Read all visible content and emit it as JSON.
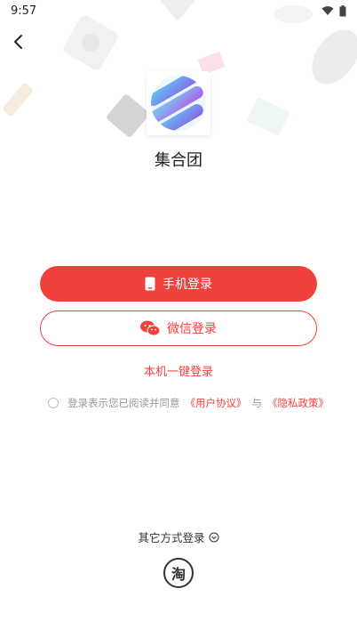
{
  "status_bar": {
    "time": "9:57"
  },
  "app": {
    "name": "集合团"
  },
  "buttons": {
    "phone_login": "手机登录",
    "wechat_login": "微信登录",
    "one_key_login": "本机一键登录"
  },
  "agreement": {
    "prefix": "登录表示您已阅读并同意",
    "user_agreement": "《用户协议》",
    "and": "与",
    "privacy_policy": "《隐私政策》"
  },
  "other": {
    "label": "其它方式登录",
    "taobao_glyph": "淘"
  },
  "colors": {
    "accent": "#f0413e"
  },
  "icons": [
    "back-arrow-icon",
    "wifi-icon",
    "battery-icon",
    "phone-icon",
    "wechat-icon",
    "chevron-down-icon"
  ]
}
